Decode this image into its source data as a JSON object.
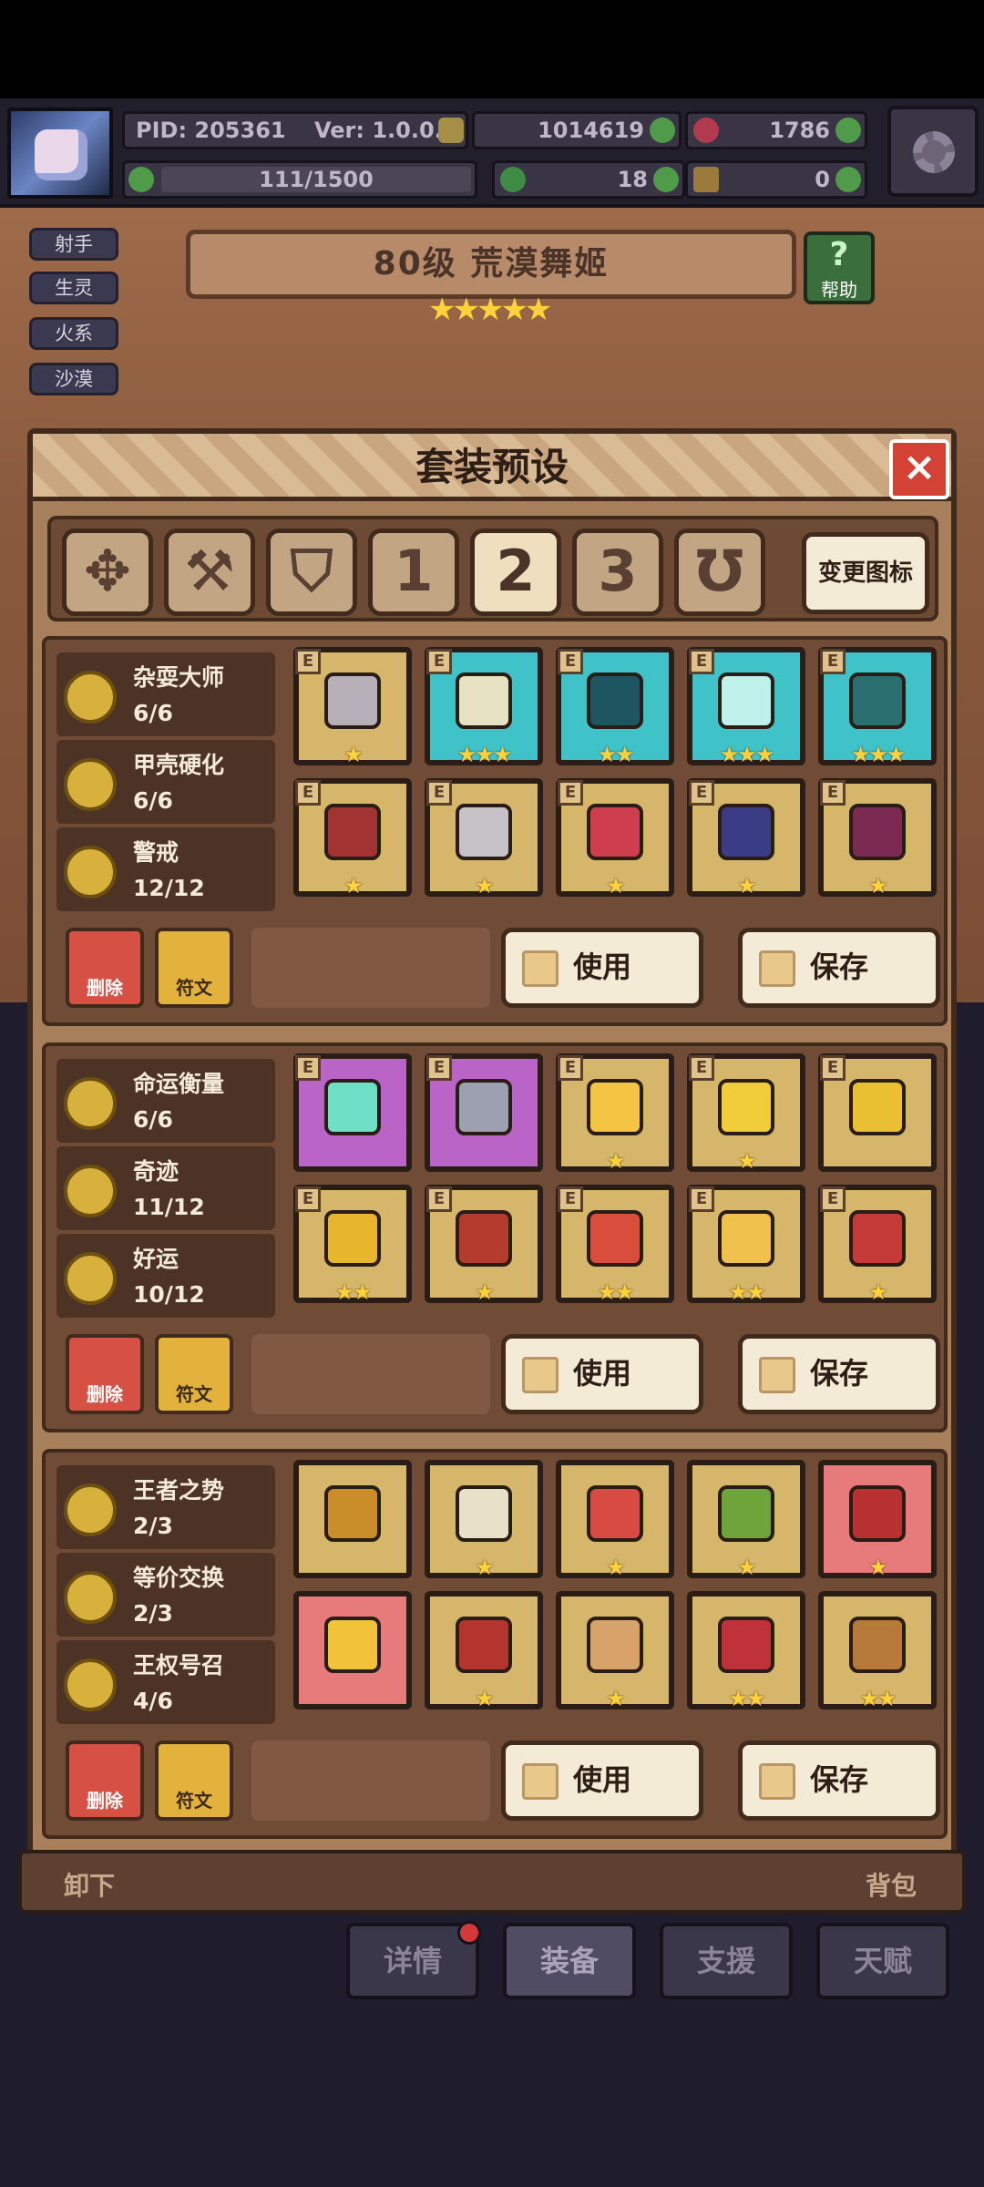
{
  "hud": {
    "pid": "PID: 205361",
    "version": "Ver: 1.0.0.7",
    "gold": "1014619",
    "gems": "1786",
    "stamina": "111/1500",
    "clover": "18",
    "boots": "0"
  },
  "side_tags": [
    "射手",
    "生灵",
    "火系",
    "沙漠"
  ],
  "hero": {
    "title": "80级 荒漠舞姬",
    "stars": "★★★★★",
    "help_label": "帮助",
    "help_icon": "?"
  },
  "modal": {
    "title": "套装预设",
    "close_icon": "×",
    "change_icon_label": "变更图标",
    "tabs": [
      {
        "label": "✥",
        "icon": "class-icon"
      },
      {
        "label": "⚒",
        "icon": "weapon-icon"
      },
      {
        "label": "⛉",
        "icon": "shield-icon"
      },
      {
        "label": "1",
        "icon": "preset-1"
      },
      {
        "label": "2",
        "icon": "preset-2"
      },
      {
        "label": "3",
        "icon": "preset-3"
      },
      {
        "label": "Ʊ",
        "icon": "horseshoe-icon"
      }
    ],
    "active_tab": 4
  },
  "presets": [
    {
      "sets": [
        {
          "name": "杂耍大师",
          "count": "6/6"
        },
        {
          "name": "甲壳硬化",
          "count": "6/6"
        },
        {
          "name": "警戒",
          "count": "12/12"
        }
      ],
      "slots": [
        {
          "color": "gold",
          "stars": "★",
          "e": "E",
          "item": "#b7b0b8"
        },
        {
          "color": "blue",
          "stars": "★★★",
          "e": "E",
          "item": "#e8e2c4"
        },
        {
          "color": "blue",
          "stars": "★★",
          "e": "E",
          "item": "#1d5560"
        },
        {
          "color": "blue",
          "stars": "★★★",
          "e": "E",
          "item": "#bff0ea"
        },
        {
          "color": "blue",
          "stars": "★★★",
          "e": "E",
          "item": "#2a6f70"
        },
        {
          "color": "gold",
          "stars": "★",
          "e": "E",
          "item": "#a33232"
        },
        {
          "color": "gold",
          "stars": "★",
          "e": "E",
          "item": "#c7c2c7"
        },
        {
          "color": "gold",
          "stars": "★",
          "e": "E",
          "item": "#cf3e4f"
        },
        {
          "color": "gold",
          "stars": "★",
          "e": "E",
          "item": "#3a3c86"
        },
        {
          "color": "gold",
          "stars": "★",
          "e": "E",
          "item": "#7b2a52"
        }
      ],
      "delete_label": "删除",
      "rune_label": "符文",
      "use_label": "使用",
      "save_label": "保存"
    },
    {
      "sets": [
        {
          "name": "命运衡量",
          "count": "6/6"
        },
        {
          "name": "奇迹",
          "count": "11/12"
        },
        {
          "name": "好运",
          "count": "10/12"
        }
      ],
      "slots": [
        {
          "color": "purple",
          "stars": "",
          "e": "E",
          "item": "#6fe0c5"
        },
        {
          "color": "purple",
          "stars": "",
          "e": "E",
          "item": "#9da0b0"
        },
        {
          "color": "gold",
          "stars": "★",
          "e": "E",
          "item": "#f4c542"
        },
        {
          "color": "gold",
          "stars": "★",
          "e": "E",
          "item": "#f2cd3a"
        },
        {
          "color": "gold",
          "stars": "",
          "e": "E",
          "item": "#e8c032"
        },
        {
          "color": "gold",
          "stars": "★★",
          "e": "E",
          "item": "#e8b62d"
        },
        {
          "color": "gold",
          "stars": "★",
          "e": "E",
          "item": "#b53b2f"
        },
        {
          "color": "gold",
          "stars": "★★",
          "e": "E",
          "item": "#d94d3c"
        },
        {
          "color": "gold",
          "stars": "★★",
          "e": "E",
          "item": "#f0c14d"
        },
        {
          "color": "gold",
          "stars": "★",
          "e": "E",
          "item": "#c33a38"
        }
      ],
      "delete_label": "删除",
      "rune_label": "符文",
      "use_label": "使用",
      "save_label": "保存"
    },
    {
      "sets": [
        {
          "name": "王者之势",
          "count": "2/3"
        },
        {
          "name": "等价交换",
          "count": "2/3"
        },
        {
          "name": "王权号召",
          "count": "4/6"
        }
      ],
      "slots": [
        {
          "color": "gold",
          "stars": "",
          "e": "",
          "item": "#c98e2a"
        },
        {
          "color": "gold",
          "stars": "★",
          "e": "",
          "item": "#e8e0c8"
        },
        {
          "color": "gold",
          "stars": "★",
          "e": "",
          "item": "#d84b45"
        },
        {
          "color": "gold",
          "stars": "★",
          "e": "",
          "item": "#6ea43a"
        },
        {
          "color": "red",
          "stars": "★",
          "e": "",
          "item": "#b8302f"
        },
        {
          "color": "red",
          "stars": "",
          "e": "",
          "item": "#f2c33a"
        },
        {
          "color": "gold",
          "stars": "★",
          "e": "",
          "item": "#b3352e"
        },
        {
          "color": "gold",
          "stars": "★",
          "e": "",
          "item": "#d7a36a"
        },
        {
          "color": "gold",
          "stars": "★★",
          "e": "",
          "item": "#c0323a"
        },
        {
          "color": "gold",
          "stars": "★★",
          "e": "",
          "item": "#b87a3a"
        }
      ],
      "delete_label": "删除",
      "rune_label": "符文",
      "use_label": "使用",
      "save_label": "保存"
    }
  ],
  "strip": {
    "left": "卸下",
    "right": "背包"
  },
  "nav": {
    "back_icon": "↩",
    "tabs": [
      "详情",
      "装备",
      "支援",
      "天赋"
    ]
  }
}
